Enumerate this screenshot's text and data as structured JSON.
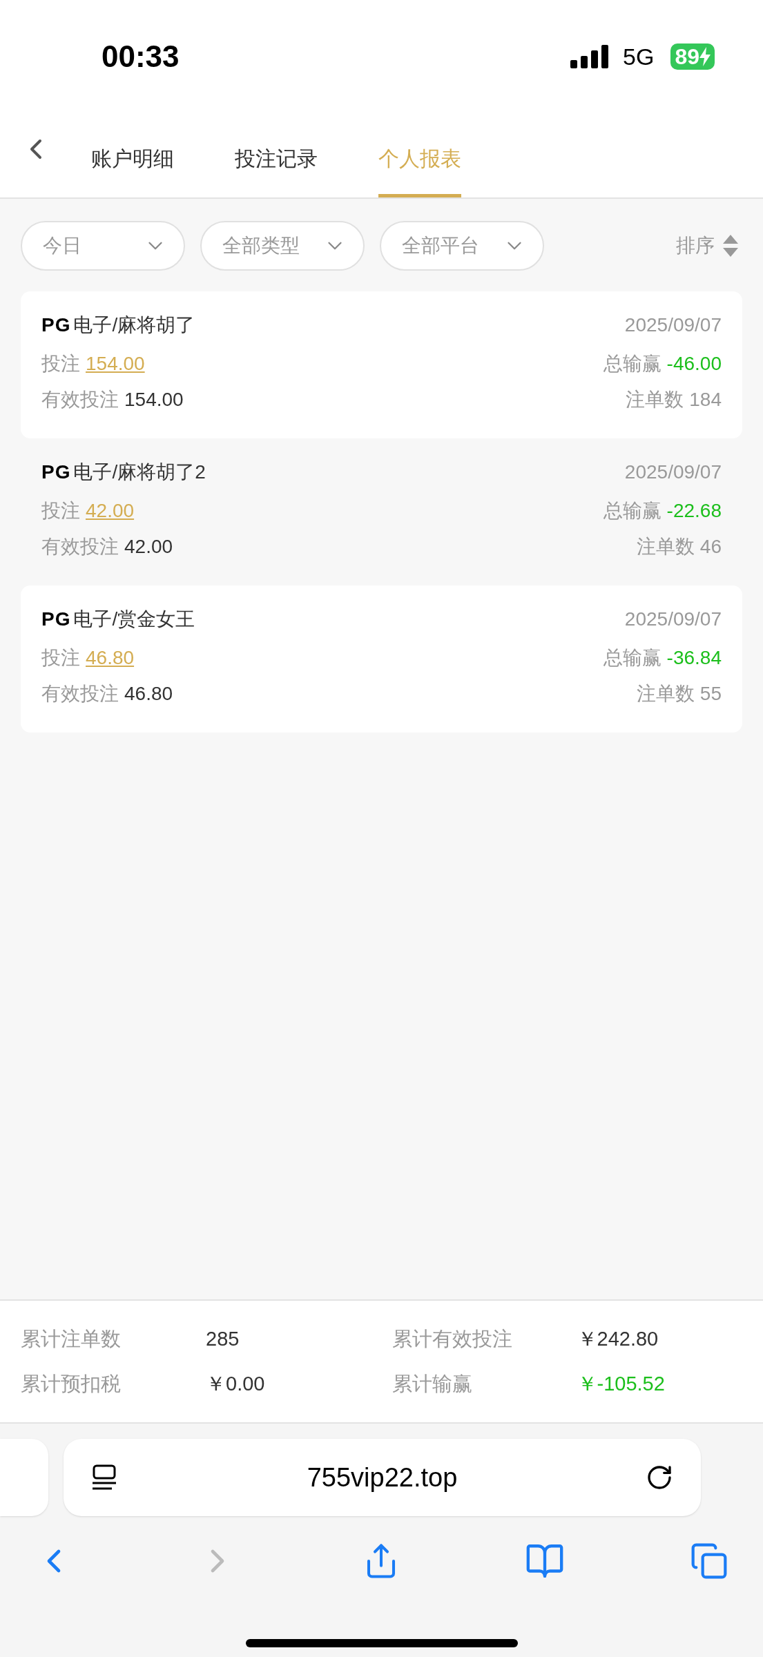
{
  "status_bar": {
    "time": "00:33",
    "network": "5G",
    "battery": "89"
  },
  "tabs": [
    {
      "label": "账户明细",
      "selected": false
    },
    {
      "label": "投注记录",
      "selected": false
    },
    {
      "label": "个人报表",
      "selected": true
    }
  ],
  "filters": [
    {
      "label": "今日"
    },
    {
      "label": "全部类型"
    },
    {
      "label": "全部平台"
    }
  ],
  "sort": {
    "label": "排序"
  },
  "records": [
    {
      "logo": "PG",
      "game": "电子/麻将胡了",
      "date": "2025/09/07",
      "bet_label": "投注",
      "bet": "154.00",
      "valid_label": "有效投注",
      "valid": "154.00",
      "winloss_label": "总输赢",
      "winloss": "-46.00",
      "count_label": "注单数",
      "count": "184"
    },
    {
      "logo": "PG",
      "game": "电子/麻将胡了2",
      "date": "2025/09/07",
      "bet_label": "投注",
      "bet": "42.00",
      "valid_label": "有效投注",
      "valid": "42.00",
      "winloss_label": "总输赢",
      "winloss": "-22.68",
      "count_label": "注单数",
      "count": "46"
    },
    {
      "logo": "PG",
      "game": "电子/赏金女王",
      "date": "2025/09/07",
      "bet_label": "投注",
      "bet": "46.80",
      "valid_label": "有效投注",
      "valid": "46.80",
      "winloss_label": "总输赢",
      "winloss": "-36.84",
      "count_label": "注单数",
      "count": "55"
    }
  ],
  "summary": [
    {
      "label": "累计注单数",
      "value": "285",
      "kind": "plain"
    },
    {
      "label": "累计有效投注",
      "value": "￥242.80",
      "kind": "plain"
    },
    {
      "label": "累计预扣税",
      "value": "￥0.00",
      "kind": "plain"
    },
    {
      "label": "累计输赢",
      "value": "￥-105.52",
      "kind": "winloss"
    }
  ],
  "browser": {
    "url": "755vip22.top"
  }
}
